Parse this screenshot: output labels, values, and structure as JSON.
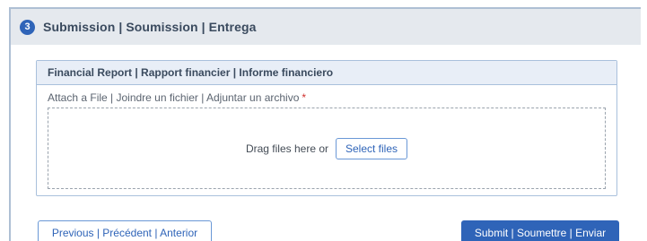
{
  "step": {
    "number": "3",
    "title": "Submission | Soumission | Entrega"
  },
  "panel": {
    "title": "Financial Report | Rapport financier | Informe financiero",
    "field_label": "Attach a File | Joindre un fichier | Adjuntar un archivo",
    "required_marker": "*",
    "drag_text": "Drag files here or",
    "select_files_label": "Select files"
  },
  "footer": {
    "previous_label": "Previous | Précédent | Anterior",
    "submit_label": "Submit | Soumettre | Enviar"
  },
  "colors": {
    "accent": "#2f64b8",
    "header_bg": "#e5e9ee",
    "panel_header_bg": "#e8eef7",
    "required": "#d0312d"
  }
}
